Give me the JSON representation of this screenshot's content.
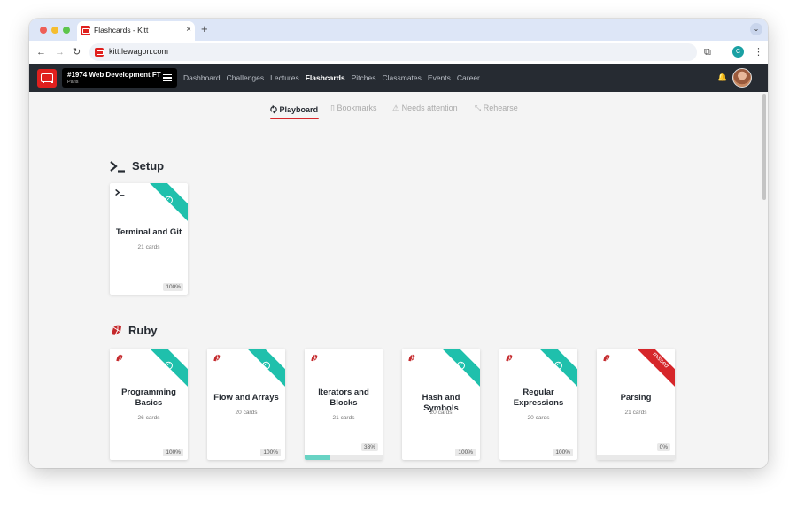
{
  "browser": {
    "tab_title": "Flashcards - Kitt",
    "tab_close": "×",
    "new_tab": "+",
    "url": "kitt.lewagon.com",
    "profile_initial": "C",
    "back": "←",
    "forward": "→",
    "reload": "↻",
    "extensions": "⧉",
    "menu": "⋮",
    "tab_menu": "⌄"
  },
  "site": {
    "batch_title": "#1974 Web Development FT",
    "batch_city": "Paris",
    "nav": [
      "Dashboard",
      "Challenges",
      "Lectures",
      "Flashcards",
      "Pitches",
      "Classmates",
      "Events",
      "Career"
    ],
    "active_nav": "Flashcards",
    "bell": "🔔"
  },
  "subtabs": [
    {
      "label": "Playboard",
      "icon": "🗘"
    },
    {
      "label": "Bookmarks",
      "icon": "▯"
    },
    {
      "label": "Needs attention",
      "icon": "⚠"
    },
    {
      "label": "Rehearse",
      "icon": "⤡"
    }
  ],
  "sections": [
    {
      "title": "Setup",
      "icon": "terminal-icon",
      "cards": [
        {
          "title": "Terminal and Git",
          "count": "21 cards",
          "progress_label": "100%",
          "progress": 1.0,
          "status": "done"
        }
      ]
    },
    {
      "title": "Ruby",
      "icon": "ruby-icon",
      "cards": [
        {
          "title": "Programming Basics",
          "count": "26 cards",
          "progress_label": "100%",
          "progress": 1.0,
          "status": "done"
        },
        {
          "title": "Flow and Arrays",
          "count": "20 cards",
          "progress_label": "100%",
          "progress": 1.0,
          "status": "done"
        },
        {
          "title": "Iterators and Blocks",
          "count": "21 cards",
          "progress_label": "33%",
          "progress": 0.33,
          "status": "in-progress"
        },
        {
          "title": "Hash and Symbols",
          "count": "20 cards",
          "progress_label": "100%",
          "progress": 1.0,
          "status": "done"
        },
        {
          "title": "Regular Expressions",
          "count": "20 cards",
          "progress_label": "100%",
          "progress": 1.0,
          "status": "done"
        },
        {
          "title": "Parsing",
          "count": "21 cards",
          "progress_label": "0%",
          "progress": 0.0,
          "status": "missed",
          "ribbon_text": "missed"
        }
      ]
    }
  ],
  "colors": {
    "ribbon_done": "#1fc0ac",
    "ribbon_missed": "#d6262a",
    "progress_fill": "#68d3c4",
    "accent_red": "#d6262a"
  }
}
